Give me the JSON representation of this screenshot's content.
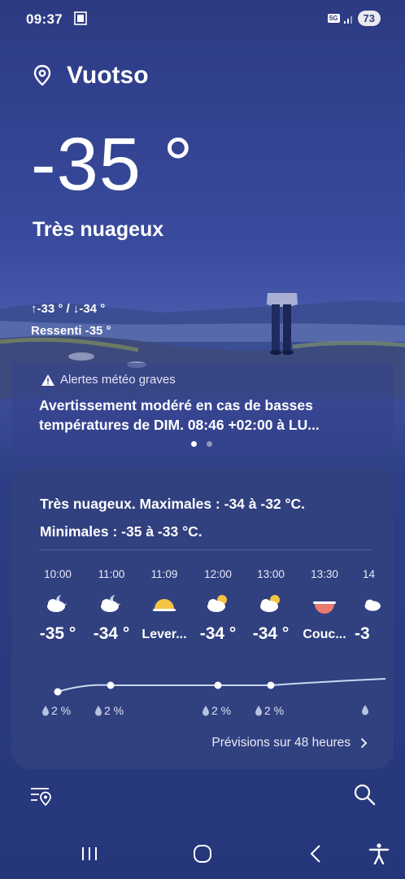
{
  "status": {
    "time": "09:37",
    "network": "5G",
    "battery": "73"
  },
  "location": {
    "name": "Vuotso",
    "icon": "location-pin-icon"
  },
  "current": {
    "temperature": "-35 °",
    "condition": "Très nuageux",
    "high_low": "↑-33 ° / ↓-34 °",
    "feels_like": "Ressenti -35 °"
  },
  "alert": {
    "title": "Alertes météo graves",
    "text": "Avertissement modéré en cas de basses températures de DIM. 08:46 +02:00 à LU..."
  },
  "forecast": {
    "summary_line1": "Très nuageux. Maximales : -34 à -32 °C.",
    "summary_line2": "Minimales : -35 à -33 °C.",
    "hours": [
      {
        "time": "10:00",
        "icon": "moon-cloud-icon",
        "value": "-35 °"
      },
      {
        "time": "11:00",
        "icon": "moon-cloud-icon",
        "value": "-34 °"
      },
      {
        "time": "11:09",
        "icon": "sunrise-icon",
        "value": "Lever..."
      },
      {
        "time": "12:00",
        "icon": "sun-cloud-icon",
        "value": "-34 °"
      },
      {
        "time": "13:00",
        "icon": "sun-cloud-icon",
        "value": "-34 °"
      },
      {
        "time": "13:30",
        "icon": "sunset-icon",
        "value": "Couc..."
      },
      {
        "time": "14",
        "icon": "cloud-icon",
        "value": "-3"
      }
    ],
    "precip": [
      "2 %",
      "2 %",
      "2 %",
      "2 %"
    ],
    "more_label": "Prévisions sur 48 heures"
  }
}
